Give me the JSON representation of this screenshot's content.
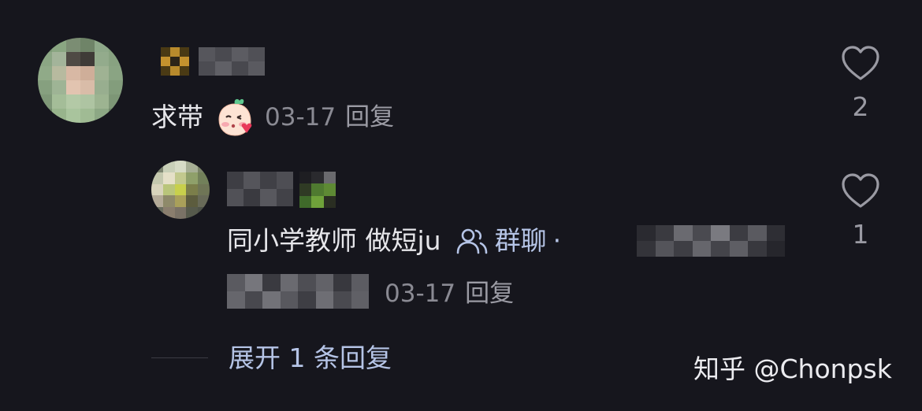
{
  "comments": [
    {
      "text": "求带",
      "emoji": "kiss-face-emoji",
      "date": "03-17",
      "reply_label": "回复",
      "like_count": "2"
    },
    {
      "text": "同小学教师 做短ju",
      "group_label": "群聊",
      "separator": "·",
      "date": "03-17",
      "reply_label": "回复",
      "like_count": "1"
    }
  ],
  "expand_label": "展开 1 条回复",
  "watermark": "知乎 @Chonpsk",
  "icons": [
    "heart-outline-icon",
    "group-chat-icon",
    "kiss-face-emoji"
  ],
  "colors": {
    "background": "#16161d",
    "primary_text": "#e6e6ea",
    "meta_text": "#8a8a93",
    "link_blue": "#b5c4e6"
  }
}
